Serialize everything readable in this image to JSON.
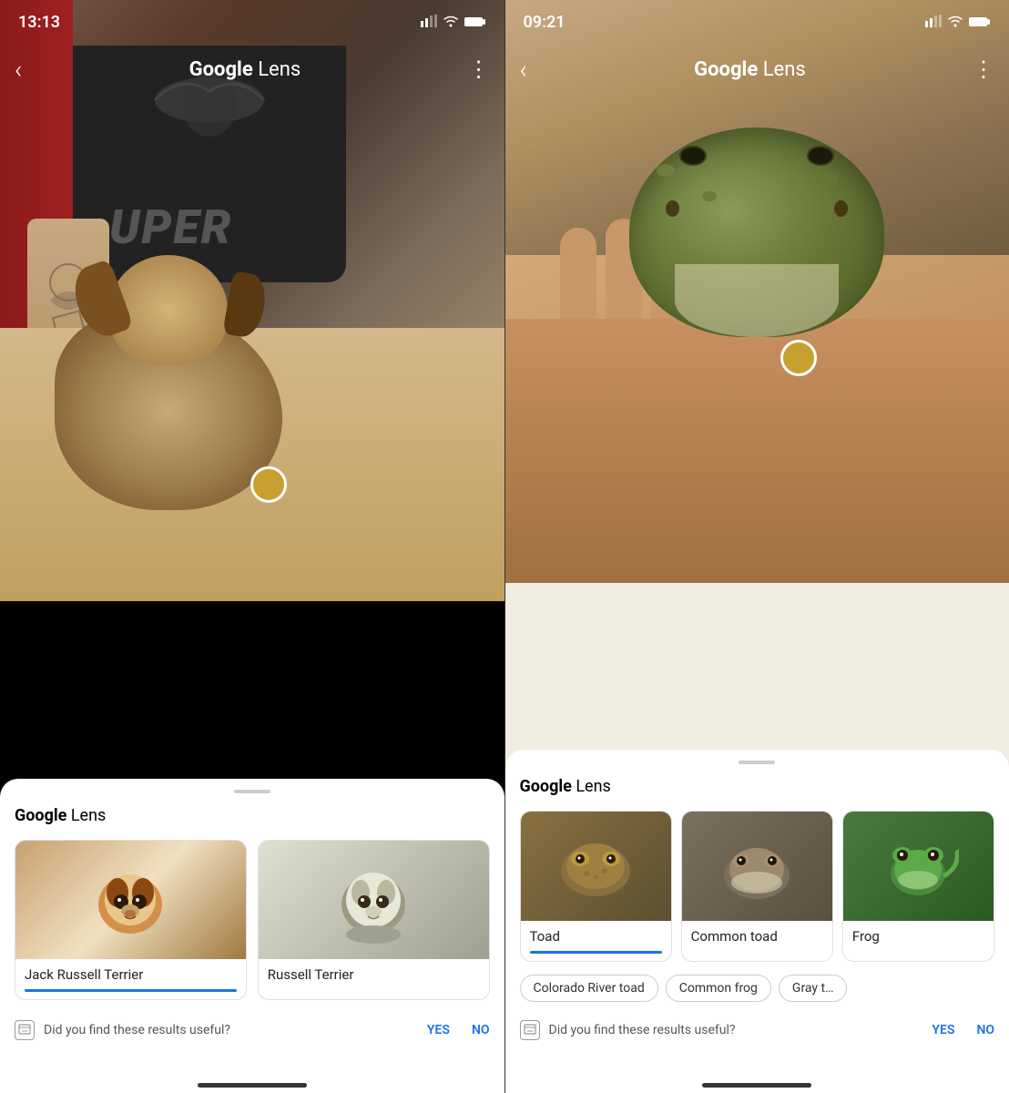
{
  "left_phone": {
    "status": {
      "time": "13:13",
      "signal": "▌▌",
      "wifi": "wifi",
      "battery": "battery"
    },
    "nav": {
      "back_label": "‹",
      "title_google": "Google",
      "title_lens": " Lens",
      "menu_label": "⋮"
    },
    "sheet": {
      "handle": "",
      "title_google": "Google",
      "title_lens": " Lens",
      "cards": [
        {
          "label": "Jack Russell Terrier",
          "emoji": "🐕",
          "selected": true
        },
        {
          "label": "Russell Terrier",
          "emoji": "🐕",
          "selected": false
        }
      ]
    },
    "feedback": {
      "question": "Did you find these results useful?",
      "yes": "YES",
      "no": "NO"
    }
  },
  "right_phone": {
    "status": {
      "time": "09:21",
      "signal": "▌▌",
      "wifi": "wifi",
      "battery": "battery"
    },
    "nav": {
      "back_label": "‹",
      "title_google": "Google",
      "title_lens": " Lens",
      "menu_label": "⋮"
    },
    "sheet": {
      "handle": "",
      "title_google": "Google",
      "title_lens": " Lens",
      "cards": [
        {
          "label": "Toad",
          "emoji": "🐸",
          "type": "toad",
          "selected": true
        },
        {
          "label": "Common toad",
          "emoji": "🐸",
          "type": "ctoad",
          "selected": false
        },
        {
          "label": "Frog",
          "emoji": "🐸",
          "type": "frog",
          "selected": false
        }
      ],
      "chips": [
        "Colorado River toad",
        "Common frog",
        "Gray t…"
      ]
    },
    "feedback": {
      "question": "Did you find these results useful?",
      "yes": "YES",
      "no": "NO"
    }
  }
}
